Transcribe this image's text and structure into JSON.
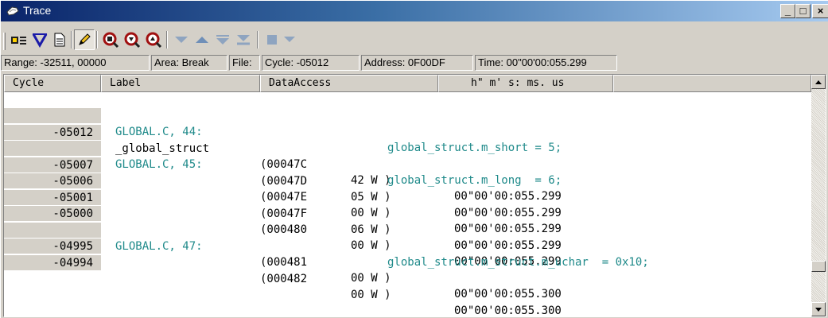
{
  "window": {
    "title": "Trace",
    "controls": {
      "minimize": "_",
      "maximize": "□",
      "close": "×"
    }
  },
  "toolbar": {
    "buttons": [
      {
        "name": "trace-start-icon",
        "pressed": false
      },
      {
        "name": "filter-icon",
        "pressed": false
      },
      {
        "name": "document-icon",
        "pressed": false
      },
      {
        "name": "edit-pencil-icon",
        "pressed": true
      },
      {
        "name": "search-trace-icon",
        "pressed": false
      },
      {
        "name": "search-forward-icon",
        "pressed": false
      },
      {
        "name": "search-backward-icon",
        "pressed": false
      },
      {
        "name": "arrow-down-disabled-icon",
        "pressed": false
      },
      {
        "name": "arrow-up-icon",
        "pressed": false
      },
      {
        "name": "step-down-disabled-icon",
        "pressed": false
      },
      {
        "name": "jump-bottom-disabled-icon",
        "pressed": false
      },
      {
        "name": "stop-disabled-icon",
        "pressed": false
      },
      {
        "name": "dropdown-disabled-icon",
        "pressed": false
      }
    ]
  },
  "info_bar": {
    "range": "Range: -32511,  00000",
    "area": "Area: Break",
    "file": "File:",
    "cycle": "Cycle: -05012",
    "address": "Address: 0F00DF",
    "time": "Time: 00\"00'00:055.299"
  },
  "columns": {
    "cycle": "Cycle",
    "label": "Label",
    "data_access": "DataAccess",
    "time": "h\" m' s: ms. us"
  },
  "rows": [
    {
      "cycle": "",
      "label": "GLOBAL.C, 44:",
      "source": "global_struct.m_short = 5;"
    },
    {
      "cycle": "-05012",
      "label": "_global_struct",
      "address": "(00047C",
      "value": "42 W )",
      "time": "00\"00'00:055.299"
    },
    {
      "cycle": "",
      "label": "GLOBAL.C, 45:",
      "source": "global_struct.m_long  = 6;"
    },
    {
      "cycle": "-05007",
      "label": "",
      "address": "(00047D",
      "value": "05 W )",
      "time": "00\"00'00:055.299"
    },
    {
      "cycle": "-05006",
      "label": "",
      "address": "(00047E",
      "value": "00 W )",
      "time": "00\"00'00:055.299"
    },
    {
      "cycle": "-05001",
      "label": "",
      "address": "(00047F",
      "value": "06 W )",
      "time": "00\"00'00:055.299"
    },
    {
      "cycle": "-05000",
      "label": "",
      "address": "(000480",
      "value": "00 W )",
      "time": "00\"00'00:055.299"
    },
    {
      "cycle": "",
      "label": "GLOBAL.C, 47:",
      "source": "global_struct.m_struct.m_uchar  = 0x10;"
    },
    {
      "cycle": "-04995",
      "label": "",
      "address": "(000481",
      "value": "00 W )",
      "time": "00\"00'00:055.300"
    },
    {
      "cycle": "-04994",
      "label": "",
      "address": "(000482",
      "value": "00 W )",
      "time": "00\"00'00:055.300"
    }
  ],
  "colors": {
    "source_text": "#1f8a8a",
    "title_bar_start": "#0a246a",
    "title_bar_end": "#a6caf0",
    "chrome": "#d4d0c8"
  }
}
